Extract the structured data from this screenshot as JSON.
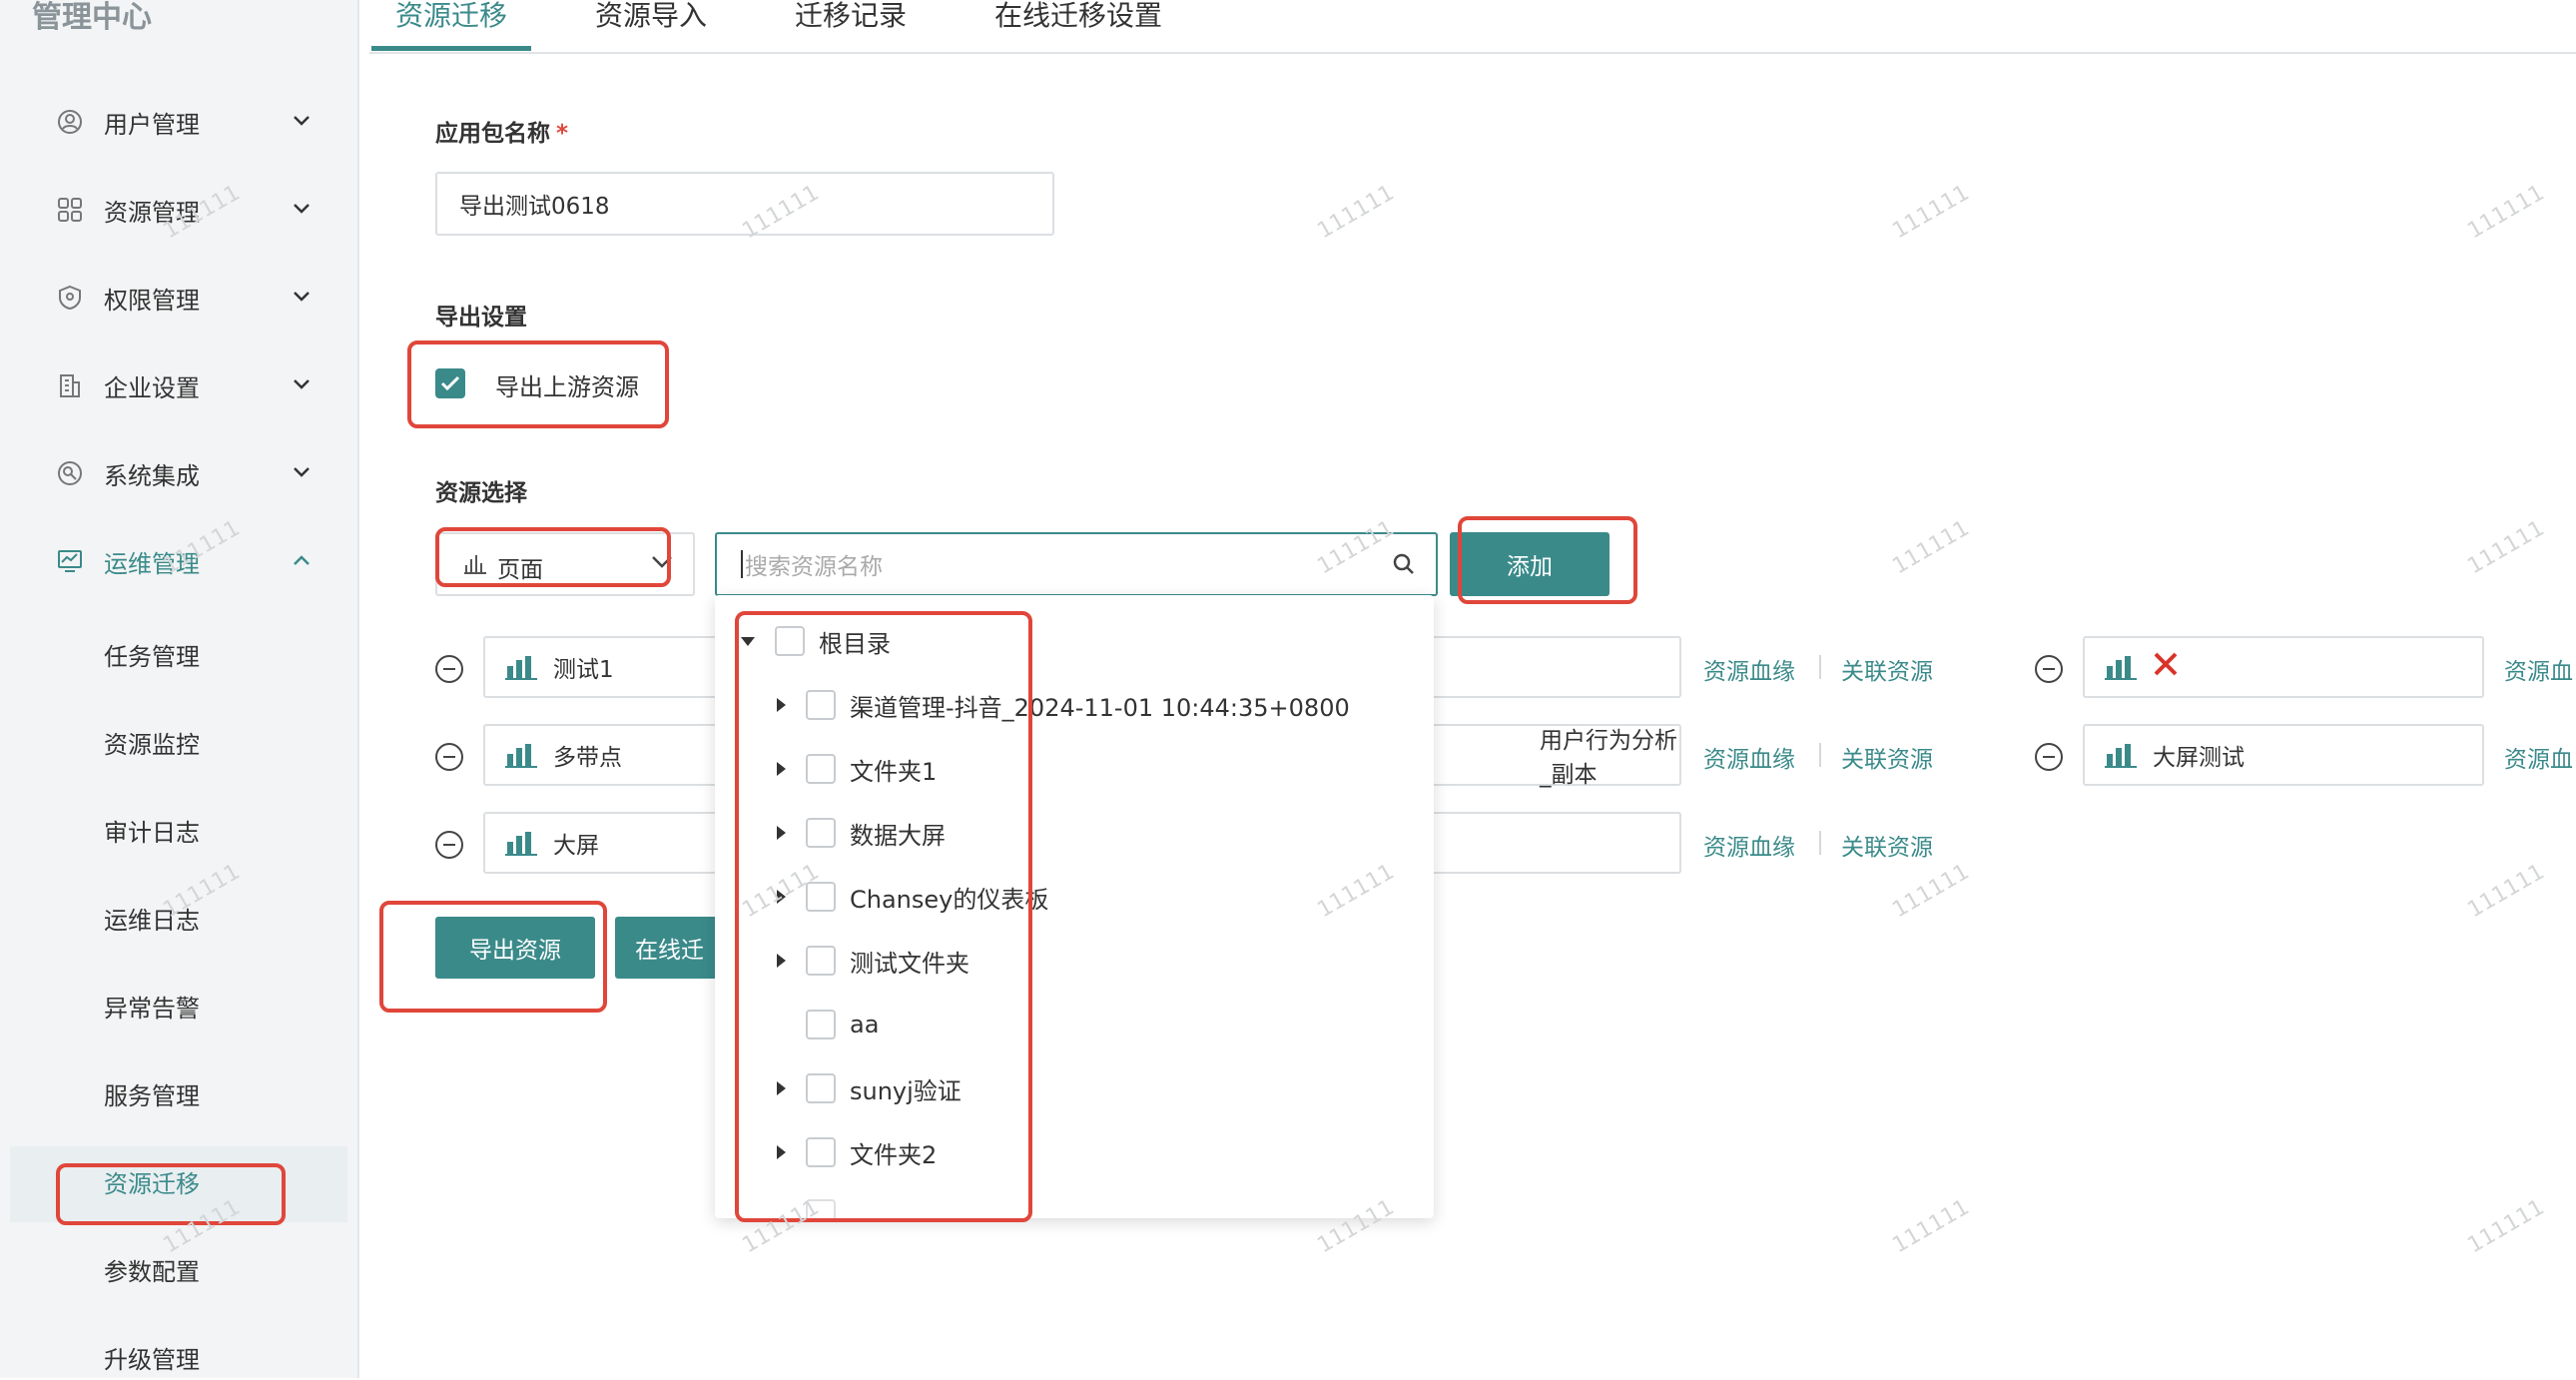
{
  "sidebar": {
    "brand": "管理中心",
    "menu": [
      {
        "label": "用户管理",
        "icon": "user-circle-icon"
      },
      {
        "label": "资源管理",
        "icon": "grid-icon"
      },
      {
        "label": "权限管理",
        "icon": "shield-icon"
      },
      {
        "label": "企业设置",
        "icon": "building-icon"
      },
      {
        "label": "系统集成",
        "icon": "integration-icon"
      },
      {
        "label": "运维管理",
        "icon": "monitor-icon"
      }
    ],
    "sub_items": [
      "任务管理",
      "资源监控",
      "审计日志",
      "运维日志",
      "异常告警",
      "服务管理",
      "资源迁移",
      "参数配置",
      "升级管理"
    ]
  },
  "tabs": [
    "资源迁移",
    "资源导入",
    "迁移记录",
    "在线迁移设置"
  ],
  "form": {
    "package_label": "应用包名称",
    "required_mark": "*",
    "package_value": "导出测试0618",
    "export_settings_label": "导出设置",
    "export_upstream_label": "导出上游资源",
    "resource_select_label": "资源选择",
    "type_value": "页面",
    "search_placeholder": "搜索资源名称",
    "add_button": "添加",
    "export_button": "导出资源",
    "online_button": "在线迁"
  },
  "resources": [
    {
      "name": "测试1",
      "middle": ""
    },
    {
      "name": "多带点",
      "middle": "用户行为分析_副本"
    },
    {
      "name": "大屏",
      "middle": ""
    }
  ],
  "resources_right": [
    {
      "name": "",
      "error": true
    },
    {
      "name": "大屏测试",
      "error": false
    }
  ],
  "links": {
    "lineage": "资源血缘",
    "related": "关联资源",
    "lineage_cut": "资源血"
  },
  "tree": [
    {
      "label": "根目录",
      "expand": "down",
      "level": 0
    },
    {
      "label": "渠道管理-抖音_2024-11-01 10:44:35+0800",
      "expand": "right",
      "level": 1
    },
    {
      "label": "文件夹1",
      "expand": "right",
      "level": 1
    },
    {
      "label": "数据大屏",
      "expand": "right",
      "level": 1
    },
    {
      "label": "Chansey的仪表板",
      "expand": "right",
      "level": 1
    },
    {
      "label": "测试文件夹",
      "expand": "right",
      "level": 1
    },
    {
      "label": "aa",
      "expand": "none",
      "level": 1
    },
    {
      "label": "sunyj验证",
      "expand": "right",
      "level": 1
    },
    {
      "label": "文件夹2",
      "expand": "right",
      "level": 1
    }
  ],
  "watermark": "111111",
  "colors": {
    "accent": "#3b8a8a",
    "highlight": "#e0463a"
  }
}
